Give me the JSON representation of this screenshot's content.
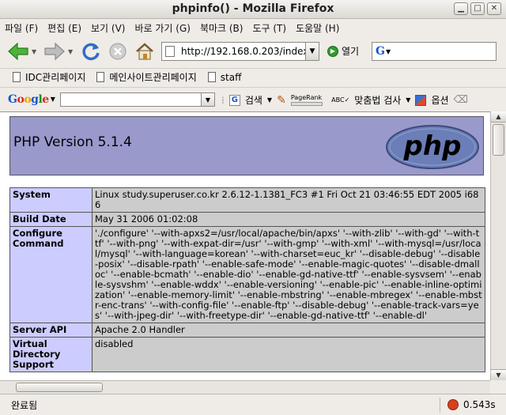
{
  "window": {
    "title": "phpinfo() - Mozilla Firefox"
  },
  "menubar": {
    "items": [
      "파일 (F)",
      "편집 (E)",
      "보기 (V)",
      "바로 가기 (G)",
      "북마크 (B)",
      "도구 (T)",
      "도움말 (H)"
    ]
  },
  "navbar": {
    "url": "http://192.168.0.203/index.",
    "go_label": "열기",
    "search_engine_letter": "G"
  },
  "bookmarks": {
    "items": [
      "IDC관리페이지",
      "메인사이트관리페이지",
      "staff"
    ]
  },
  "googlebar": {
    "logo": "Google",
    "search_label": "검색",
    "pagerank_label": "PageRank",
    "spell_label": "맞춤법 검사",
    "options_label": "옵션"
  },
  "page": {
    "header": "PHP Version 5.1.4",
    "logo_text": "php",
    "rows": [
      {
        "key": "System",
        "value": "Linux study.superuser.co.kr 2.6.12-1.1381_FC3 #1 Fri Oct 21 03:46:55 EDT 2005 i686"
      },
      {
        "key": "Build Date",
        "value": "May 31 2006 01:02:08"
      },
      {
        "key": "Configure Command",
        "value": "'./configure' '--with-apxs2=/usr/local/apache/bin/apxs' '--with-zlib' '--with-gd' '--with-ttf' '--with-png' '--with-expat-dir=/usr' '--with-gmp' '--with-xml' '--with-mysql=/usr/local/mysql' '--with-language=korean' '--with-charset=euc_kr' '--disable-debug' '--disable-posix' '--disable-rpath' '--enable-safe-mode' '--enable-magic-quotes' '--disable-dmalloc' '--enable-bcmath' '--enable-dio' '--enable-gd-native-ttf' '--enable-sysvsem' '--enable-sysvshm' '--enable-wddx' '--enable-versioning' '--enable-pic' '--enable-inline-optimization' '--enable-memory-limit' '--enable-mbstring' '--enable-mbregex' '--enable-mbstr-enc-trans' '--with-config-file' '--enable-ftp' '--disable-debug' '--enable-track-vars=yes' '--with-jpeg-dir' '--with-freetype-dir' '--enable-gd-native-ttf' '--enable-dl'"
      },
      {
        "key": "Server API",
        "value": "Apache 2.0 Handler"
      },
      {
        "key": "Virtual Directory Support",
        "value": "disabled"
      }
    ]
  },
  "status": {
    "text": "완료됨",
    "timing": "0.543s"
  }
}
